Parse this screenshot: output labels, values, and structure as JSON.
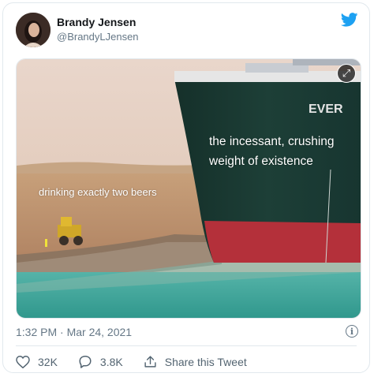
{
  "author": {
    "display_name": "Brandy Jensen",
    "handle": "@BrandyLJensen"
  },
  "media": {
    "caption_left": "drinking exactly two beers",
    "caption_ship": "the incessant, crushing weight of existence",
    "ship_text": "EVER",
    "expand_icon": "expand-icon"
  },
  "meta": {
    "timestamp": "1:32 PM · Mar 24, 2021"
  },
  "actions": {
    "like_count": "32K",
    "reply_count": "3.8K",
    "share_label": "Share this Tweet"
  },
  "colors": {
    "twitter_blue": "#1da1f2",
    "text_primary": "#14171a",
    "text_secondary": "#657786"
  }
}
